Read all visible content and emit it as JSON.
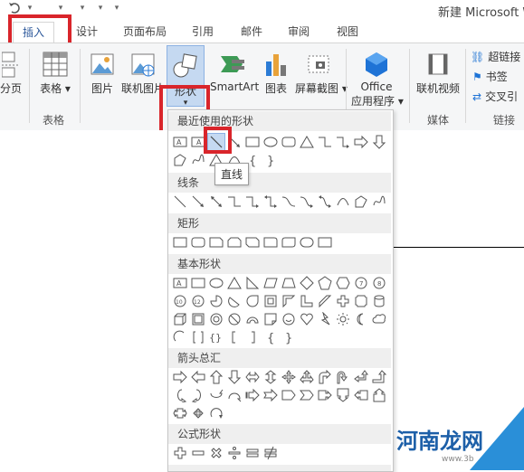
{
  "title_bar": {
    "doc_title": "新建 Microsoft W"
  },
  "tabs": [
    {
      "label": "插入",
      "active": true
    },
    {
      "label": "设计"
    },
    {
      "label": "页面布局"
    },
    {
      "label": "引用"
    },
    {
      "label": "邮件"
    },
    {
      "label": "审阅"
    },
    {
      "label": "视图"
    }
  ],
  "ribbon": {
    "page_label": "分页",
    "table_label": "表格",
    "table_group": "表格",
    "picture": "图片",
    "online_picture": "联机图片",
    "shapes": "形状",
    "smartart": "SmartArt",
    "chart": "图表",
    "screenshot": "屏幕截图",
    "office_apps_line1": "Office",
    "office_apps_line2": "应用程序",
    "online_video": "联机视频",
    "media_group": "媒体",
    "hyperlink": "超链接",
    "bookmark": "书签",
    "crossref": "交叉引",
    "links_group": "链接"
  },
  "dropdown": {
    "recent": "最近使用的形状",
    "lines": "线条",
    "rectangles": "矩形",
    "basic": "基本形状",
    "arrows": "箭头总汇",
    "equation": "公式形状",
    "tooltip": "直线"
  },
  "watermark": {
    "brand": "河南龙网",
    "url": "www.3b"
  },
  "colors": {
    "accent": "#2b579a",
    "highlight_red": "#d9252b",
    "shape_selected": "#c5d9f1"
  }
}
